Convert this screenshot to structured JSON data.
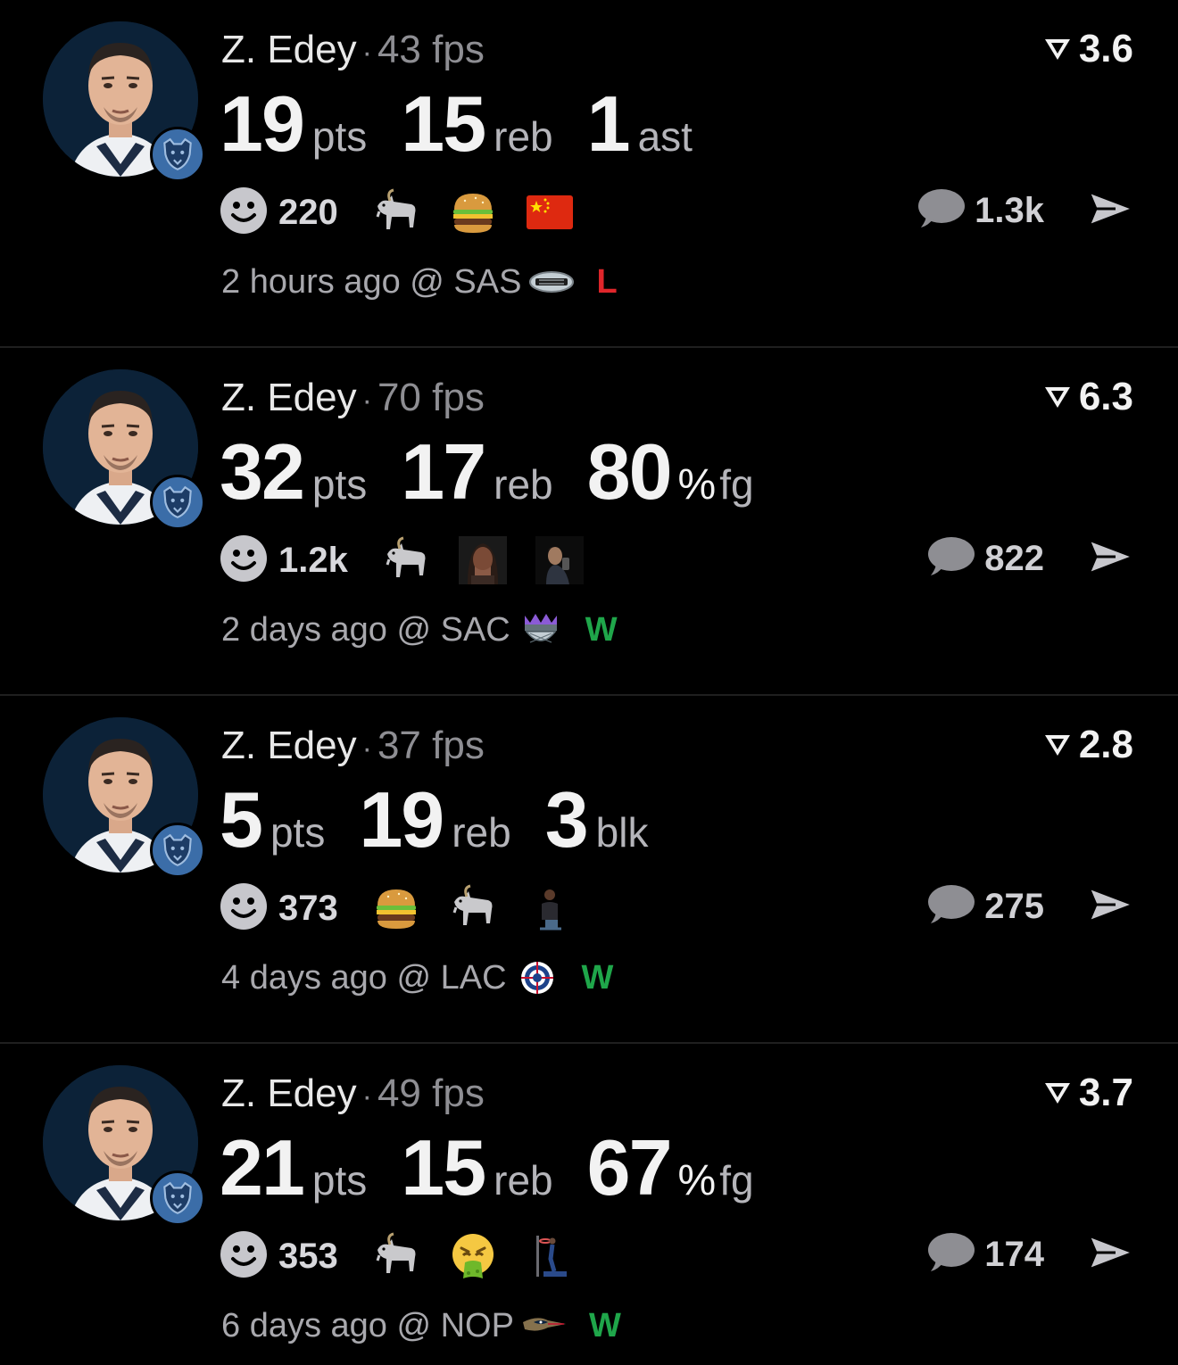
{
  "posts": [
    {
      "player": "Z. Edey",
      "fps": "43 fps",
      "rating": "3.6",
      "stats": [
        {
          "value": "19",
          "unit": "pts"
        },
        {
          "value": "15",
          "unit": "reb"
        },
        {
          "value": "1",
          "unit": "ast"
        }
      ],
      "reactions_count": "220",
      "reaction_emojis": [
        "goat-emoji",
        "burger-emoji",
        "china-flag-emoji"
      ],
      "comments_count": "1.3k",
      "time_ago": "2 hours ago",
      "at_label": "@ SAS",
      "opponent_logo": "spurs-logo",
      "result": "L",
      "result_color": "#e0262b"
    },
    {
      "player": "Z. Edey",
      "fps": "70 fps",
      "rating": "6.3",
      "stats": [
        {
          "value": "32",
          "unit": "pts"
        },
        {
          "value": "17",
          "unit": "reb"
        },
        {
          "value": "80",
          "pct": "%",
          "unit": "fg"
        }
      ],
      "reactions_count": "1.2k",
      "reaction_emojis": [
        "goat-emoji",
        "crying-person-image",
        "man-on-phone-image"
      ],
      "comments_count": "822",
      "time_ago": "2 days ago",
      "at_label": "@ SAC",
      "opponent_logo": "kings-logo",
      "result": "W",
      "result_color": "#1fa64a"
    },
    {
      "player": "Z. Edey",
      "fps": "37 fps",
      "rating": "2.8",
      "stats": [
        {
          "value": "5",
          "unit": "pts"
        },
        {
          "value": "19",
          "unit": "reb"
        },
        {
          "value": "3",
          "unit": "blk"
        }
      ],
      "reactions_count": "373",
      "reaction_emojis": [
        "burger-emoji",
        "goat-emoji",
        "sitting-person-image"
      ],
      "comments_count": "275",
      "time_ago": "4 days ago",
      "at_label": "@ LAC",
      "opponent_logo": "clippers-logo",
      "result": "W",
      "result_color": "#1fa64a"
    },
    {
      "player": "Z. Edey",
      "fps": "49 fps",
      "rating": "3.7",
      "stats": [
        {
          "value": "21",
          "unit": "pts"
        },
        {
          "value": "15",
          "unit": "reb"
        },
        {
          "value": "67",
          "pct": "%",
          "unit": "fg"
        }
      ],
      "reactions_count": "353",
      "reaction_emojis": [
        "goat-emoji",
        "vomiting-face-emoji",
        "dunk-image"
      ],
      "comments_count": "174",
      "time_ago": "6 days ago",
      "at_label": "@ NOP",
      "opponent_logo": "pelicans-logo",
      "result": "W",
      "result_color": "#1fa64a"
    }
  ],
  "colors": {
    "background": "#000000",
    "loss": "#e0262b",
    "win": "#1fa64a",
    "muted_text": "#8e8e93",
    "team_badge": "#3b6da8"
  }
}
